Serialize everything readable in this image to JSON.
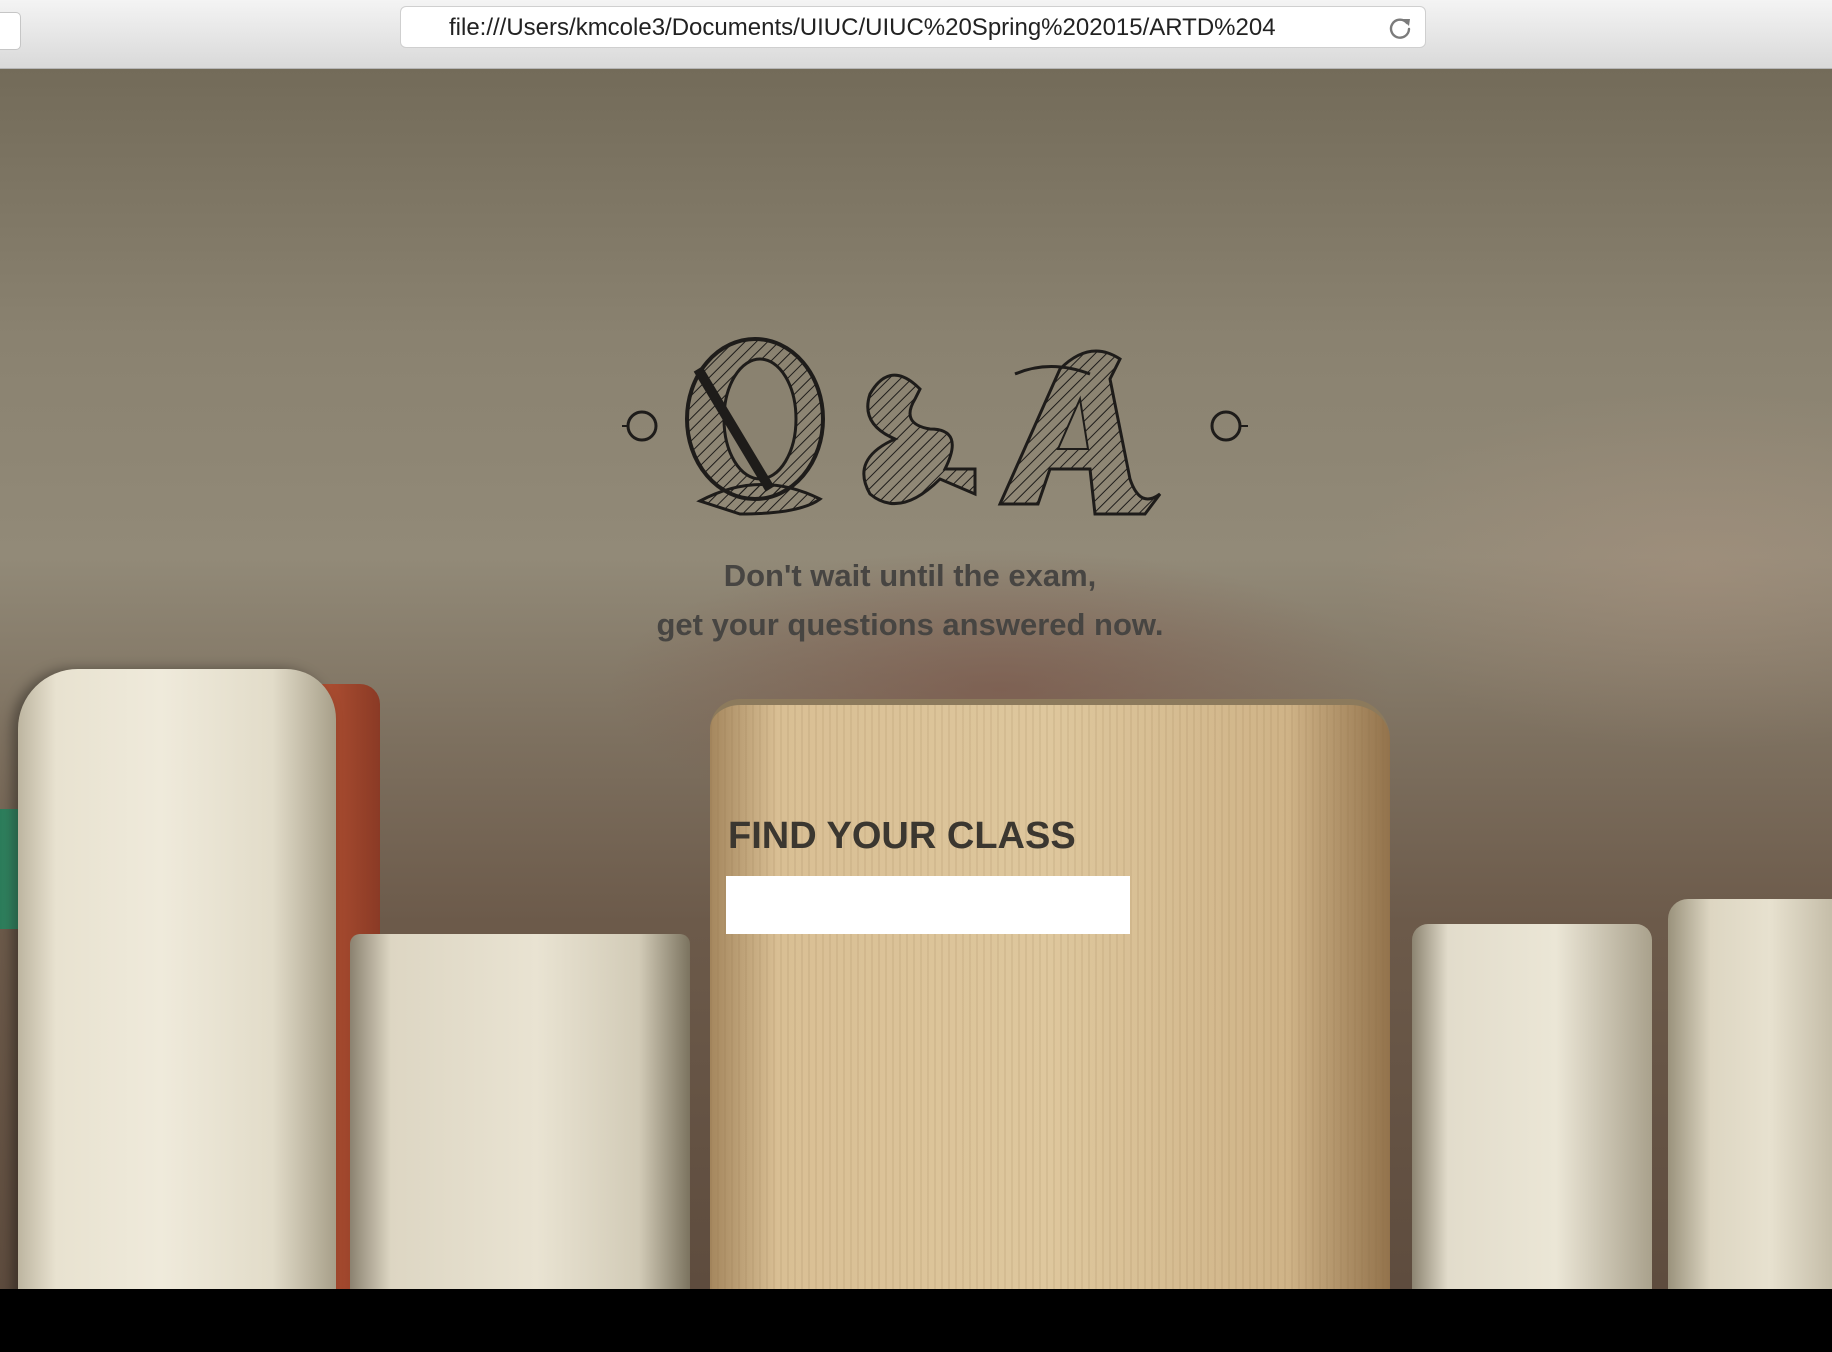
{
  "browser": {
    "url": "file:///Users/kmcole3/Documents/UIUC/UIUC%20Spring%202015/ARTD%204",
    "reload_icon": "reload-icon"
  },
  "hero": {
    "logo_text": "Q&A",
    "tagline_line1": "Don't wait until the exam,",
    "tagline_line2": "get your questions answered now."
  },
  "search": {
    "label": "FIND YOUR CLASS",
    "value": "",
    "placeholder": ""
  },
  "colors": {
    "tagline": "#474542",
    "label": "#3b3730",
    "input_bg": "#ffffff"
  }
}
